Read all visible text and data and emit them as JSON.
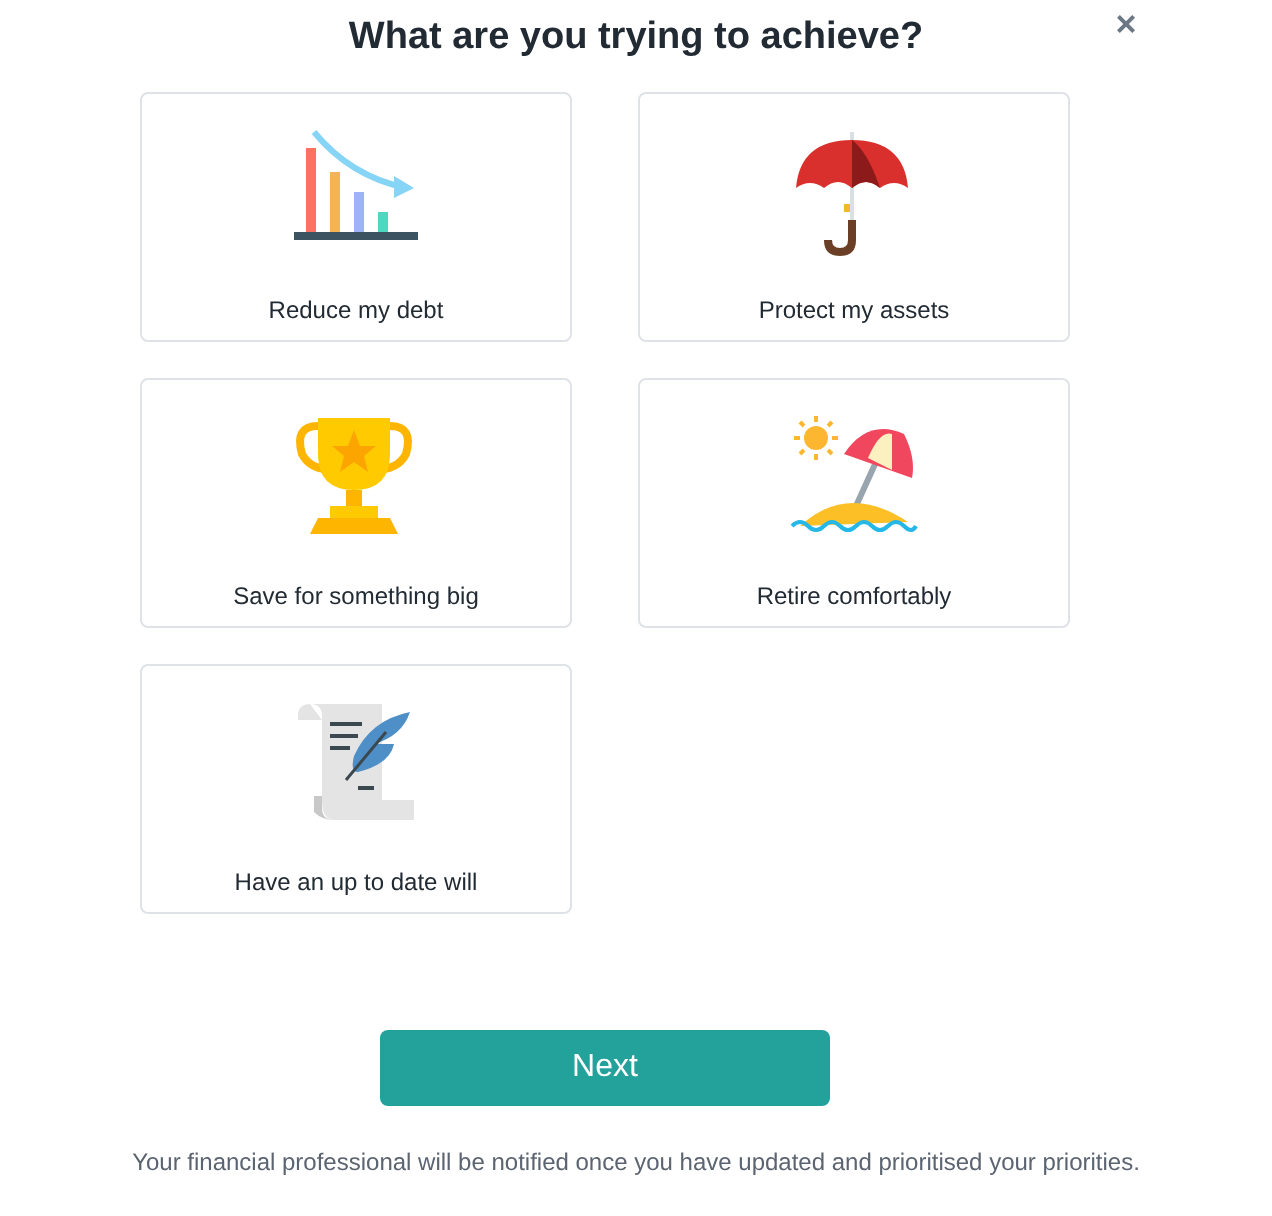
{
  "title": "What are you trying to achieve?",
  "close": "×",
  "goals": [
    {
      "kind": "debt",
      "label": "Reduce my debt"
    },
    {
      "kind": "protect",
      "label": "Protect my assets"
    },
    {
      "kind": "save",
      "label": "Save for something big"
    },
    {
      "kind": "retire",
      "label": "Retire comfortably"
    },
    {
      "kind": "will",
      "label": "Have an up to date will"
    }
  ],
  "next_button": "Next",
  "footer": "Your financial professional will be notified once you have updated and prioritised your priorities."
}
